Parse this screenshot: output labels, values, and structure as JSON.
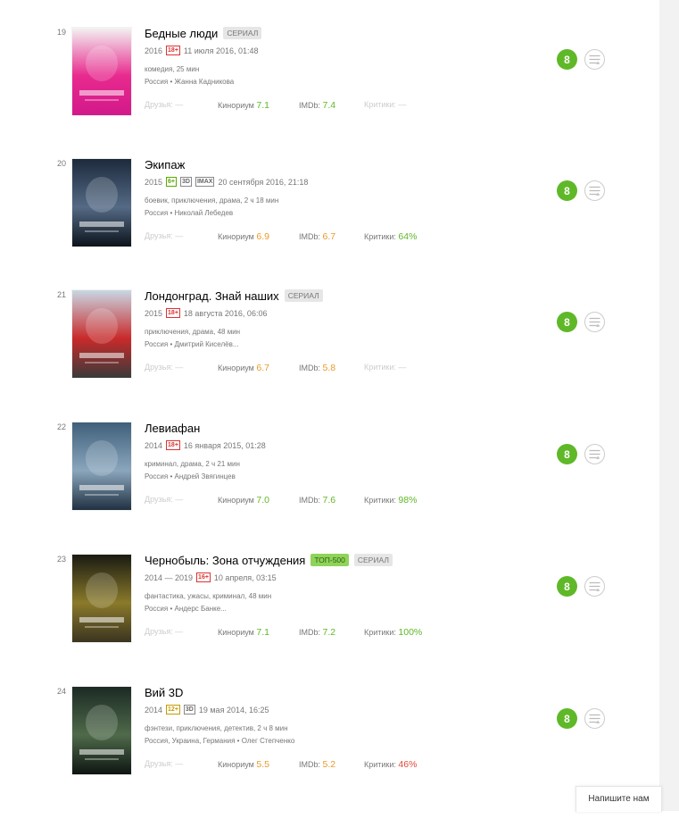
{
  "items": [
    {
      "rank": "19",
      "title": "Бедные люди",
      "badges": [
        "СЕРИАЛ"
      ],
      "year": "2016",
      "age": "18+",
      "formats": [],
      "date": "11 июля 2016, 01:48",
      "genre": "комедия, 25 мин",
      "crew": "Россия • Жанна Кадникова",
      "friends": "Друзья: —",
      "kp_label": "Кинориум",
      "kp_value": "7.1",
      "kp_color": "green",
      "imdb_label": "IMDb:",
      "imdb_value": "7.4",
      "imdb_color": "green",
      "critics_label": "Критики:",
      "critics_value": "—",
      "critics_color": "none",
      "ok_label": "8",
      "poster_colors": [
        "#f3f3f3",
        "#e82a8e",
        "#d2198a"
      ]
    },
    {
      "rank": "20",
      "title": "Экипаж",
      "badges": [],
      "year": "2015",
      "age": "6+",
      "formats": [
        "3D",
        "IMAX"
      ],
      "date": "20 сентября 2016, 21:18",
      "genre": "боевик, приключения, драма, 2 ч 18 мин",
      "crew": "Россия • Николай Лебедев",
      "friends": "Друзья: —",
      "kp_label": "Кинориум",
      "kp_value": "6.9",
      "kp_color": "orange",
      "imdb_label": "IMDb:",
      "imdb_value": "6.7",
      "imdb_color": "orange",
      "critics_label": "Критики:",
      "critics_value": "64%",
      "critics_color": "green",
      "ok_label": "8",
      "poster_colors": [
        "#1d2a3c",
        "#546a85",
        "#0d131c"
      ]
    },
    {
      "rank": "21",
      "title": "Лондонград. Знай наших",
      "badges": [
        "СЕРИАЛ"
      ],
      "year": "2015",
      "age": "18+",
      "formats": [],
      "date": "18 августа 2016, 06:06",
      "genre": "приключения, драма, 48 мин",
      "crew": "Россия • Дмитрий Киселёв...",
      "friends": "Друзья: —",
      "kp_label": "Кинориум",
      "kp_value": "6.7",
      "kp_color": "orange",
      "imdb_label": "IMDb:",
      "imdb_value": "5.8",
      "imdb_color": "orange",
      "critics_label": "Критики:",
      "critics_value": "—",
      "critics_color": "none",
      "ok_label": "8",
      "poster_colors": [
        "#c8d7e4",
        "#c92a2a",
        "#3a3a3a"
      ]
    },
    {
      "rank": "22",
      "title": "Левиафан",
      "badges": [],
      "year": "2014",
      "age": "18+",
      "formats": [],
      "date": "16 января 2015, 01:28",
      "genre": "криминал, драма, 2 ч 21 мин",
      "crew": "Россия • Андрей Звягинцев",
      "friends": "Друзья: —",
      "kp_label": "Кинориум",
      "kp_value": "7.0",
      "kp_color": "green",
      "imdb_label": "IMDb:",
      "imdb_value": "7.6",
      "imdb_color": "green",
      "critics_label": "Критики:",
      "critics_value": "98%",
      "critics_color": "green",
      "ok_label": "8",
      "poster_colors": [
        "#3f5f7a",
        "#8aa6bd",
        "#203141"
      ]
    },
    {
      "rank": "23",
      "title": "Чернобыль: Зона отчуждения",
      "badges": [
        "ТОП-500",
        "СЕРИАЛ"
      ],
      "year": "2014 — 2019",
      "age": "16+",
      "formats": [],
      "date": "10 апреля, 03:15",
      "genre": "фантастика, ужасы, криминал, 48 мин",
      "crew": "Россия • Андерс Банке...",
      "friends": "Друзья: —",
      "kp_label": "Кинориум",
      "kp_value": "7.1",
      "kp_color": "green",
      "imdb_label": "IMDb:",
      "imdb_value": "7.2",
      "imdb_color": "green",
      "critics_label": "Критики:",
      "critics_value": "100%",
      "critics_color": "green",
      "ok_label": "8",
      "poster_colors": [
        "#1a1a12",
        "#8a7a2a",
        "#3b3420"
      ]
    },
    {
      "rank": "24",
      "title": "Вий 3D",
      "badges": [],
      "year": "2014",
      "age": "12+",
      "formats": [
        "3D"
      ],
      "date": "19 мая 2014, 16:25",
      "genre": "фэнтези, приключения, детектив, 2 ч 8 мин",
      "crew": "Россия, Украина, Германия • Олег Степченко",
      "friends": "Друзья: —",
      "kp_label": "Кинориум",
      "kp_value": "5.5",
      "kp_color": "orange",
      "imdb_label": "IMDb:",
      "imdb_value": "5.2",
      "imdb_color": "orange",
      "critics_label": "Критики:",
      "critics_value": "46%",
      "critics_color": "red",
      "ok_label": "8",
      "poster_colors": [
        "#1c2a24",
        "#4f6a4a",
        "#0e1512"
      ]
    }
  ],
  "feedback": "Напишите нам"
}
